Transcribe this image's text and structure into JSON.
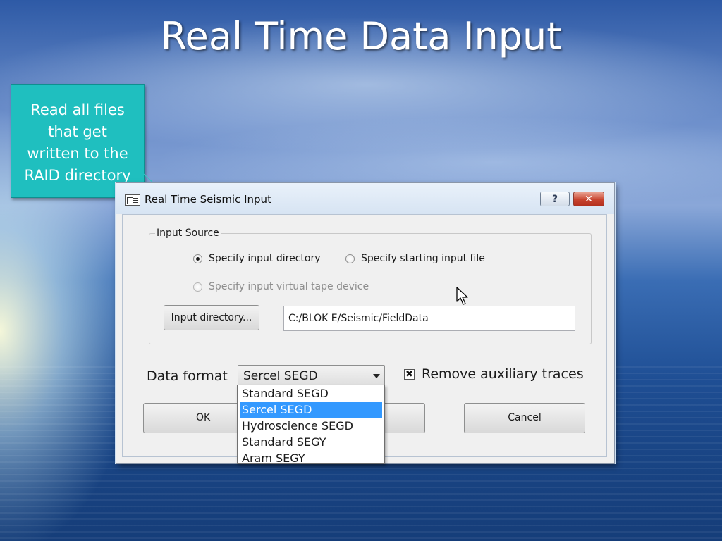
{
  "slide": {
    "title": "Real Time Data Input",
    "callout_text": "Read all files\nthat get\nwritten to the\nRAID directory"
  },
  "dialog": {
    "title": "Real Time Seismic Input",
    "help_label": "?",
    "close_label": "✕",
    "input_source": {
      "legend": "Input Source",
      "options": [
        {
          "label": "Specify input directory",
          "selected": true,
          "enabled": true
        },
        {
          "label": "Specify starting input file",
          "selected": false,
          "enabled": true
        },
        {
          "label": "Specify input virtual tape device",
          "selected": false,
          "enabled": false
        }
      ],
      "dir_button_label": "Input directory...",
      "dir_value": "C:/BLOK E/Seismic/FieldData"
    },
    "data_format": {
      "label": "Data format",
      "selected": "Sercel SEGD",
      "options": [
        "Standard SEGD",
        "Sercel SEGD",
        "Hydroscience SEGD",
        "Standard SEGY",
        "Aram SEGY"
      ]
    },
    "remove_aux": {
      "label": "Remove auxiliary traces",
      "checked": true,
      "check_glyph": "✖"
    },
    "ok_label": "OK",
    "cancel_label": "Cancel"
  },
  "colors": {
    "callout_bg": "#1fbfbf",
    "selection": "#3399ff",
    "close_button": "#c8442f"
  }
}
